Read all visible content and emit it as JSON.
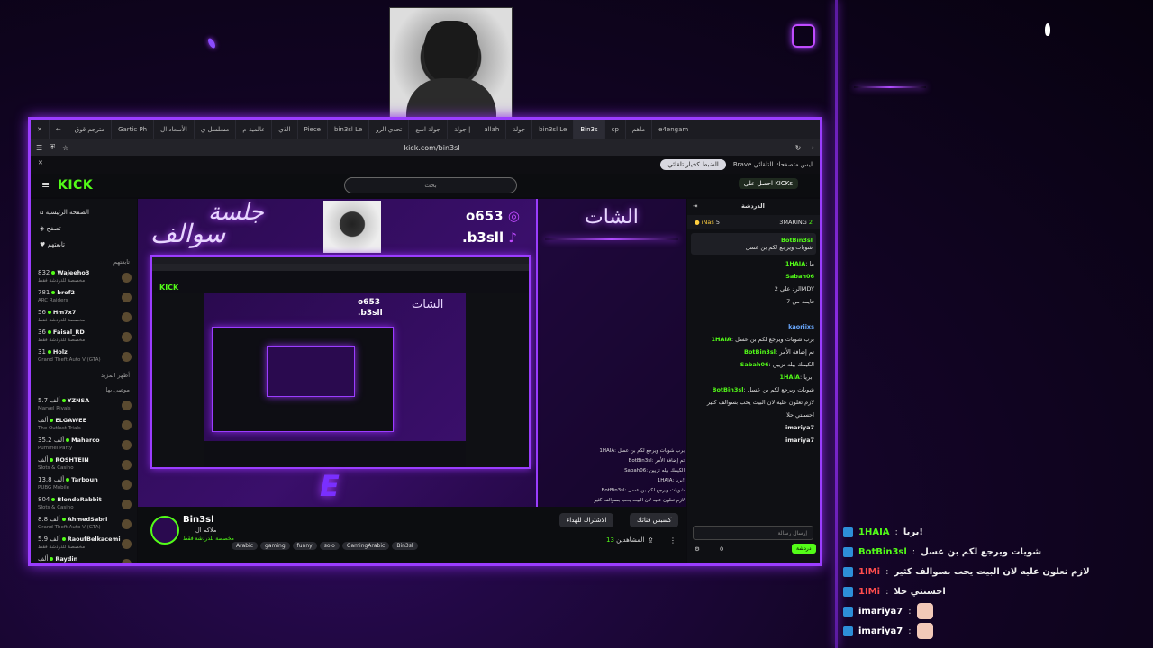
{
  "browser": {
    "tabs": [
      "مترجم قوق",
      "Gartic Ph",
      "الأسعاد ال",
      "مسلسل ي",
      "عالمية م",
      "الذي",
      "Piece",
      "bin3sl Le",
      "تحدي الرو",
      "جولة اسع",
      "جولة |",
      "allah",
      "جولة",
      "bin3sl Le",
      "Bin3s",
      "cp",
      "ماهم",
      "e4engam"
    ],
    "active_tab": "Bin3s",
    "url": "kick.com/bin3sl",
    "infobar_text": "Brave ليس متصفحك التلقائي",
    "infobar_button": "الضبط كخيار تلقائي"
  },
  "kick": {
    "logo": "KICK",
    "search_placeholder": "بحث",
    "kicks_button": "احصل على KICKs",
    "nav": [
      "الصفحة الرئيسية",
      "تصفح",
      "تابعتهم"
    ],
    "followed_header": "تابعتهم",
    "followed": [
      {
        "count": "832",
        "name": "Wajeeho3",
        "sub": "مخصصة للدردشة فقط"
      },
      {
        "count": "781",
        "name": "brof2",
        "sub": "ARC Raiders"
      },
      {
        "count": "56",
        "name": "Hm7x7",
        "sub": "مخصصة للدردشة فقط"
      },
      {
        "count": "36",
        "name": "Faisal_RD",
        "sub": "مخصصة للدردشة فقط"
      },
      {
        "count": "31",
        "name": "Holz",
        "sub": "Grand Theft Auto V (GTA)"
      }
    ],
    "show_more": "أظهر المزيد",
    "recommended_header": "موصى بها",
    "recommended": [
      {
        "count": "5.7 ألف",
        "name": "YZNSA",
        "sub": "Marvel Rivals"
      },
      {
        "count": "ألف",
        "name": "ELGAWEE",
        "sub": "The Outlast Trials"
      },
      {
        "count": "35.2 ألف",
        "name": "Maherco",
        "sub": "Pummel Party"
      },
      {
        "count": "ألف",
        "name": "ROSHTEIN",
        "sub": "Slots & Casino"
      },
      {
        "count": "13.8 ألف",
        "name": "Tarboun",
        "sub": "PUBG Mobile"
      },
      {
        "count": "804",
        "name": "BlondeRabbit",
        "sub": "Slots & Casino"
      },
      {
        "count": "8.8 ألف",
        "name": "AhmedSabri",
        "sub": "Grand Theft Auto V (GTA)"
      },
      {
        "count": "5.9 ألف",
        "name": "RaoufBelkacemi",
        "sub": "مخصصة للدردشة فقط"
      },
      {
        "count": "ألف",
        "name": "Raydin",
        "sub": "Counter-Strike 2"
      }
    ],
    "overlay": {
      "title_top": "جلسة",
      "title_bottom": "سوالف",
      "chat_title": "الشات",
      "instagram": "o653",
      "tiktok": ".b3sll"
    },
    "streamer": {
      "name": "Bin3sl",
      "title": "ملاكم ال",
      "category": "مخصصة للدردشة فقط",
      "tags": [
        "Arabic",
        "gaming",
        "funny",
        "solo",
        "GamingArabic",
        "Bin3sl"
      ],
      "viewers_label": "المشاهدين",
      "viewers": "13",
      "follow": "الاشتراك للهداء",
      "subscribe": "كسبس قناتك"
    },
    "chat": {
      "title": "الدردشة",
      "pinned_user": "BotBin3sl",
      "pinned_msg": "شويات ويرجع لكم بن عسل",
      "leaders": [
        {
          "user": "iNas",
          "points": "5"
        },
        {
          "user": "3MARING",
          "points": "2"
        }
      ],
      "lines": [
        {
          "user": "1HAIA",
          "msg": "ما",
          "cls": ""
        },
        {
          "user": "Sabah06",
          "msg": "",
          "cls": ""
        },
        {
          "user": "",
          "msg": "الرد على 2MDY",
          "cls": ""
        },
        {
          "user": "",
          "msg": "فايمه من 7",
          "cls": ""
        },
        {
          "user": "",
          "msg": "",
          "cls": ""
        },
        {
          "user": "kaoriixs",
          "msg": "",
          "cls": "blue"
        },
        {
          "user": "1HAIA",
          "msg": "برب شويات ويرجع لكم بن عسل",
          "cls": ""
        },
        {
          "user": "BotBin3sl",
          "msg": "تم إضافة الأمر",
          "cls": ""
        },
        {
          "user": "Sabah06",
          "msg": "الكيمك بيله تزيين",
          "cls": ""
        },
        {
          "user": "1HAIA",
          "msg": "بريا!",
          "cls": ""
        },
        {
          "user": "BotBin3sl",
          "msg": "شويات ويرجع لكم بن عسل",
          "cls": ""
        },
        {
          "user": "",
          "msg": "لازم تعلون عليه لان البيت يحب بسوالف كثير",
          "cls": ""
        },
        {
          "user": "",
          "msg": "احسنتي حلا",
          "cls": "red"
        },
        {
          "user": "imariya7",
          "msg": "",
          "cls": "white"
        },
        {
          "user": "imariya7",
          "msg": "",
          "cls": "white"
        }
      ],
      "input_placeholder": "إرسال رسالة",
      "chat_button": "دردشة",
      "viewers_count": "0"
    }
  },
  "outside_chat": [
    {
      "user": "1HAIA",
      "msg": "بريا!",
      "color": "#53fc18",
      "emote": false
    },
    {
      "user": "BotBin3sl",
      "msg": "شويات ويرجع لكم بن عسل",
      "color": "#53fc18",
      "emote": false
    },
    {
      "user": "1IMi",
      "msg": "لازم تعلون عليه لان البيت يحب بسوالف كثير",
      "color": "#ff4d4d",
      "emote": false
    },
    {
      "user": "1IMi",
      "msg": "احسنتي حلا",
      "color": "#ff4d4d",
      "emote": false
    },
    {
      "user": "imariya7",
      "msg": "",
      "color": "#ffffff",
      "emote": true
    },
    {
      "user": "imariya7",
      "msg": "",
      "color": "#ffffff",
      "emote": true
    }
  ]
}
